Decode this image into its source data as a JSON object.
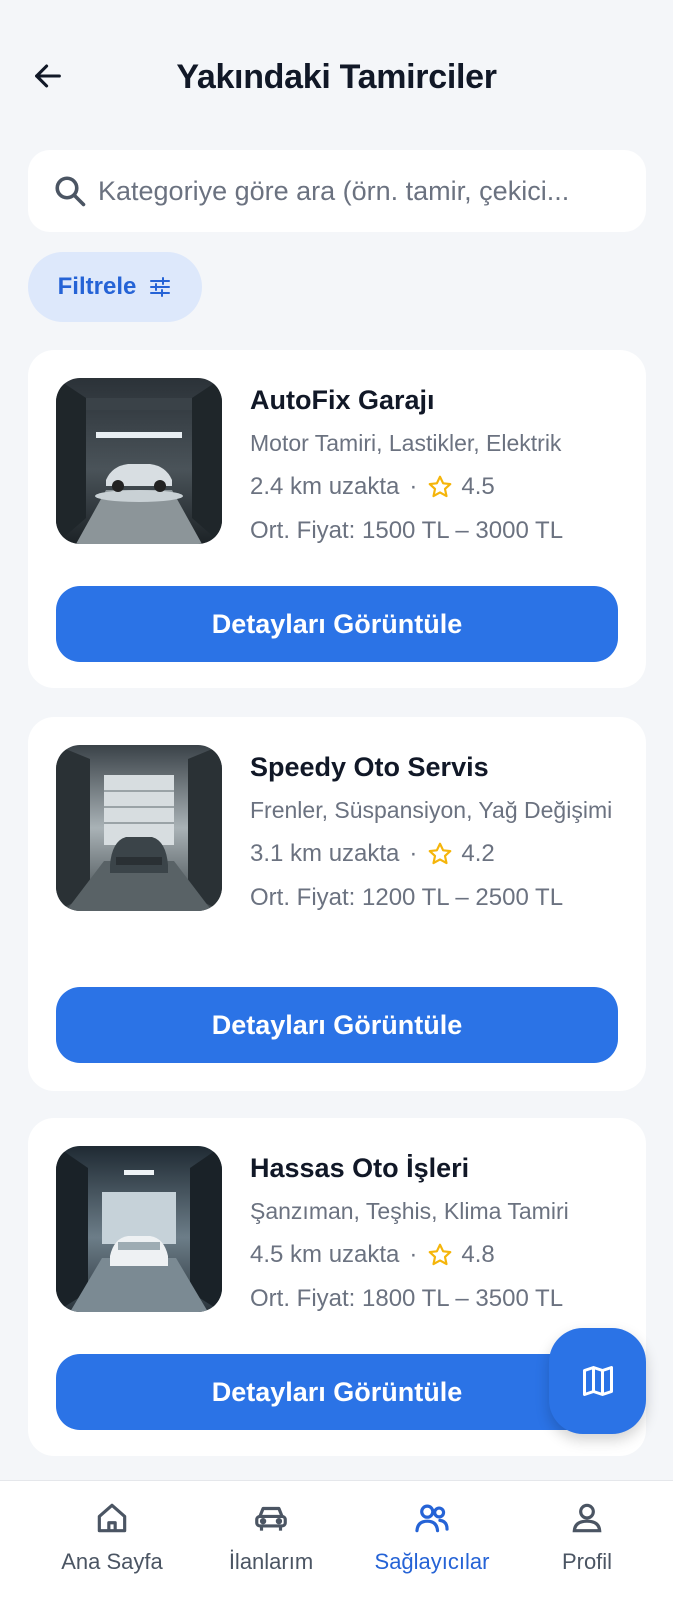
{
  "header": {
    "title": "Yakındaki Tamirciler",
    "back_icon": "arrow-left-icon"
  },
  "search": {
    "placeholder": "Kategoriye göre ara (örn. tamir, çekici...",
    "value": ""
  },
  "filter": {
    "label": "Filtrele",
    "icon": "sliders-icon"
  },
  "providers": [
    {
      "name": "AutoFix Garajı",
      "categories": "Motor Tamiri, Lastikler, Elektrik",
      "distance": "2.4 km uzakta",
      "rating": "4.5",
      "price": "Ort. Fiyat: 1500 TL – 3000 TL",
      "button": "Detayları Görüntüle"
    },
    {
      "name": "Speedy Oto Servis",
      "categories": "Frenler, Süspansiyon, Yağ Değişimi",
      "distance": "3.1 km uzakta",
      "rating": "4.2",
      "price": "Ort. Fiyat: 1200 TL – 2500 TL",
      "button": "Detayları Görüntüle"
    },
    {
      "name": "Hassas Oto İşleri",
      "categories": "Şanzıman, Teşhis, Klima Tamiri",
      "distance": "4.5 km uzakta",
      "rating": "4.8",
      "price": "Ort. Fiyat: 1800 TL – 3500 TL",
      "button": "Detayları Görüntüle"
    }
  ],
  "fab": {
    "icon": "map-icon"
  },
  "nav": {
    "items": [
      {
        "label": "Ana Sayfa",
        "icon": "home-icon",
        "active": false
      },
      {
        "label": "İlanlarım",
        "icon": "car-icon",
        "active": false
      },
      {
        "label": "Sağlayıcılar",
        "icon": "users-icon",
        "active": true
      },
      {
        "label": "Profil",
        "icon": "person-icon",
        "active": false
      }
    ]
  },
  "colors": {
    "accent": "#2b73e6",
    "background": "#f4f6f9",
    "star": "#f5b50a",
    "filter_bg": "#dde8fb"
  }
}
